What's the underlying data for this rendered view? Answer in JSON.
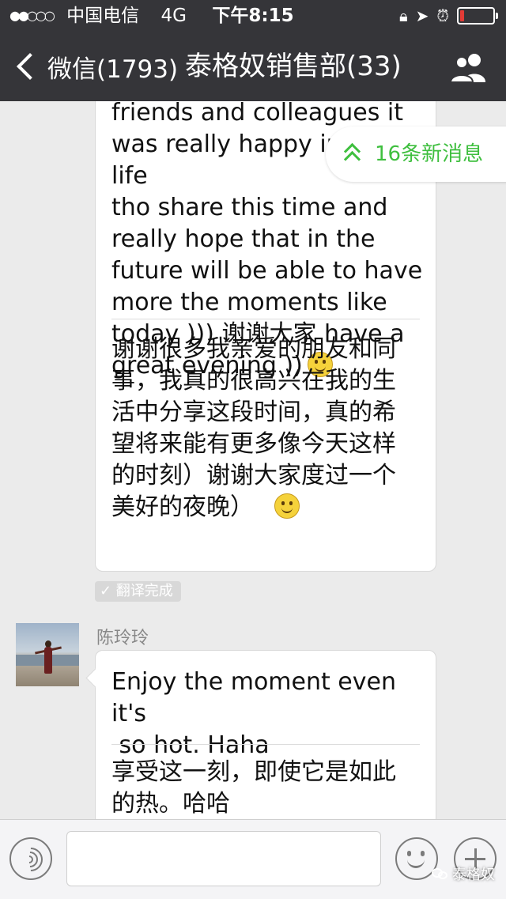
{
  "status_bar": {
    "signal": "●●○○○",
    "carrier": "中国电信",
    "network": "4G",
    "time": "下午8:15"
  },
  "nav": {
    "back_label": "微信(1793)",
    "title": "泰格奴销售部(33)"
  },
  "new_messages": {
    "label": "16条新消息"
  },
  "messages": [
    {
      "original": "friends and colleagues it\nwas really happy in my life\ntho share this time and\nreally hope that in the\nfuture will be able to have\nmore the moments like\ntoday ))) 谢谢大家 have a\ngreat evening ))",
      "translation": "谢谢很多我亲爱的朋友和同\n事，我真的很高兴在我的生\n活中分享这段时间，真的希\n望将来能有更多像今天这样\n的时刻）谢谢大家度过一个\n美好的夜晚）",
      "translation_status": "✓ 翻译完成"
    },
    {
      "sender": "陈玲玲",
      "original": "Enjoy the moment even it's\n so hot. Haha",
      "translation": "享受这一刻，即使它是如此\n的热。哈哈"
    }
  ],
  "watermark": "泰格奴",
  "colors": {
    "header_bg": "#353539",
    "chat_bg": "#ebebeb",
    "accent_green": "#3fbf3f",
    "battery_red": "#e23b36"
  },
  "icons": {
    "back": "chevron-left-icon",
    "group": "group-members-icon",
    "new_messages": "double-chevron-up-icon",
    "voice": "voice-icon",
    "emoji": "emoji-icon",
    "more": "plus-icon"
  }
}
